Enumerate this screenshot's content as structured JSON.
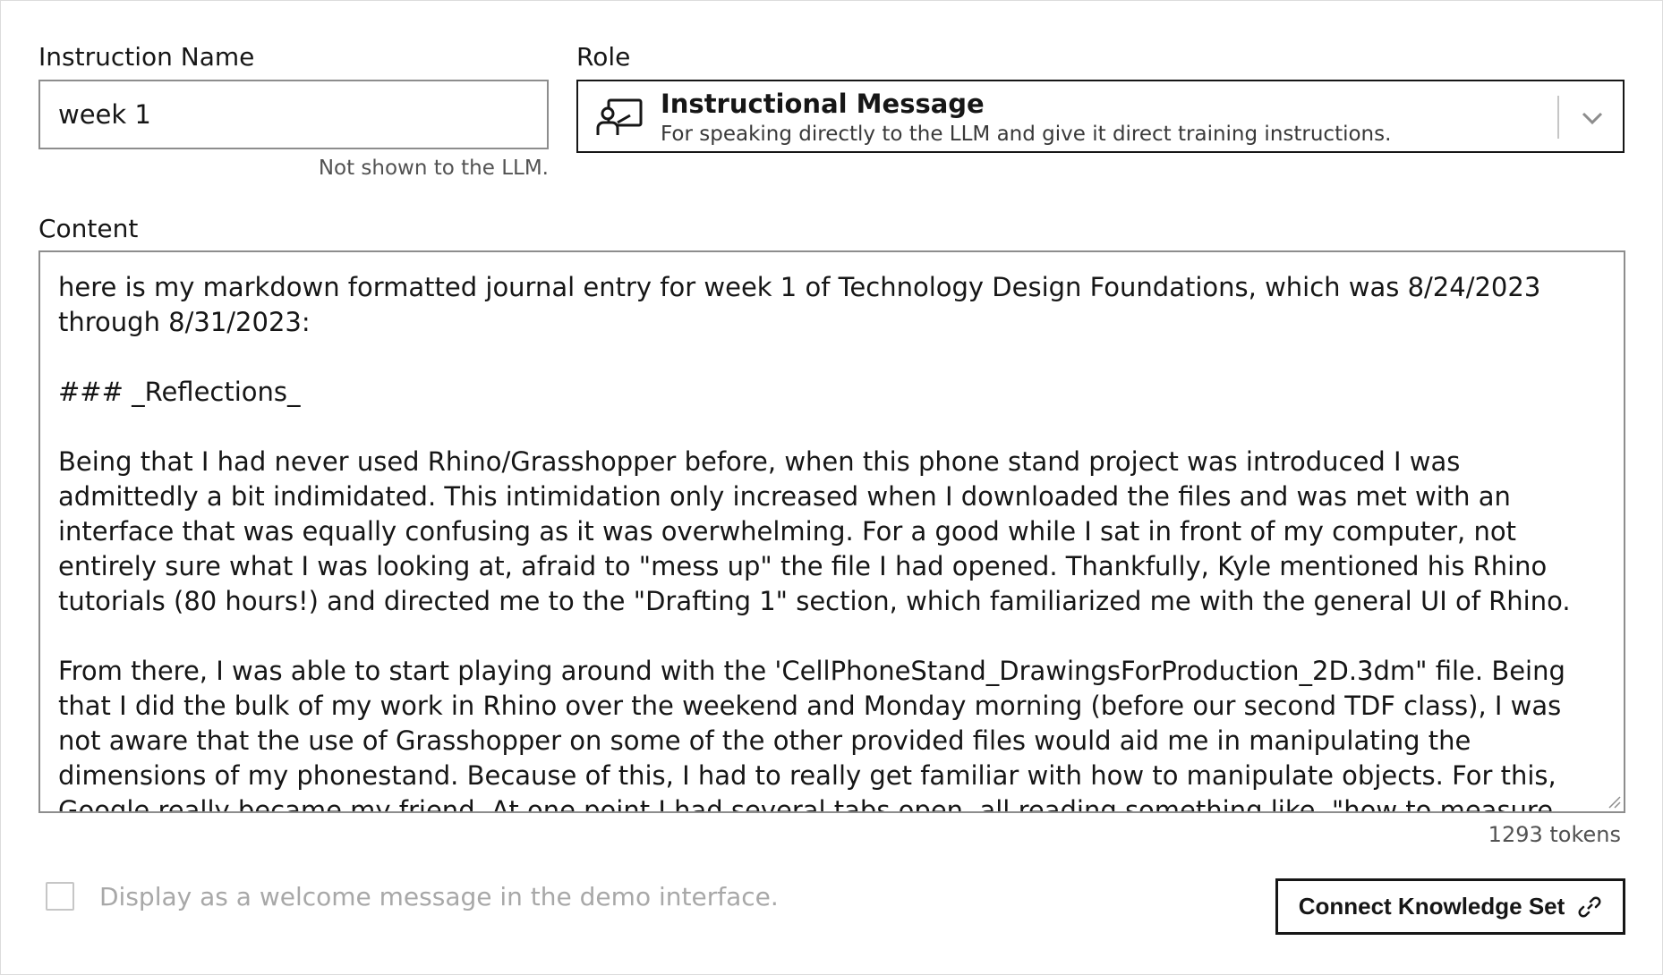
{
  "instruction_name": {
    "label": "Instruction Name",
    "value": "week 1",
    "helper": "Not shown to the LLM."
  },
  "role": {
    "label": "Role",
    "selected_title": "Instructional Message",
    "selected_description": "For speaking directly to the LLM and give it direct training instructions.",
    "icon": "person-presenting-icon"
  },
  "content": {
    "label": "Content",
    "text": "here is my markdown formatted journal entry for week 1 of Technology Design Foundations, which was 8/24/2023 through 8/31/2023:\n\n### _Reflections_\n\nBeing that I had never used Rhino/Grasshopper before, when this phone stand project was introduced I was admittedly a bit indimidated. This intimidation only increased when I downloaded the files and was met with an interface that was equally confusing as it was overwhelming. For a good while I sat in front of my computer, not entirely sure what I was looking at, afraid to \"mess up\" the file I had opened. Thankfully, Kyle mentioned his Rhino tutorials (80 hours!) and directed me to the \"Drafting 1\" section, which familiarized me with the general UI of Rhino.\n\nFrom there, I was able to start playing around with the 'CellPhoneStand_DrawingsForProduction_2D.3dm\" file. Being that I did the bulk of my work in Rhino over the weekend and Monday morning (before our second TDF class), I was not aware that the use of Grasshopper on some of the other provided files would aid me in manipulating the dimensions of my phonestand. Because of this, I had to really get familiar with how to manipulate objects. For this, Google really became my friend. At one point I had several tabs open, all reading something like, \"how to measure length of a line in Rhino\", \"how to measure angles in Rhino\", and",
    "tokens": "1293 tokens"
  },
  "welcome_checkbox": {
    "label": "Display as a welcome message in the demo interface.",
    "checked": false
  },
  "connect_button": {
    "label": "Connect Knowledge Set",
    "icon": "link-icon"
  }
}
